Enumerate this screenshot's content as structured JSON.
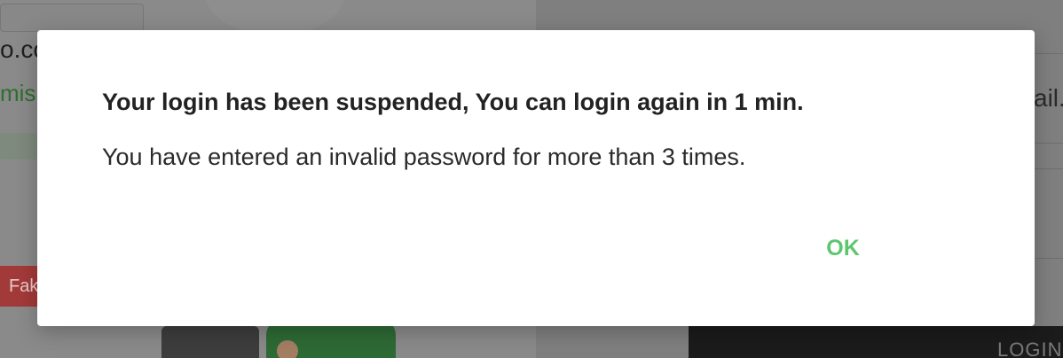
{
  "background": {
    "left_text": "o.co",
    "left_green_text": "mis.",
    "left_pill_text": "Fak",
    "right_text": "ail.c",
    "login_button_text": "LOGIN"
  },
  "dialog": {
    "title": "Your login has been suspended, You can login again in 1 min.",
    "message": "You have entered an invalid password for more than 3 times.",
    "ok_label": "OK",
    "accent_color": "#5dc66e"
  }
}
